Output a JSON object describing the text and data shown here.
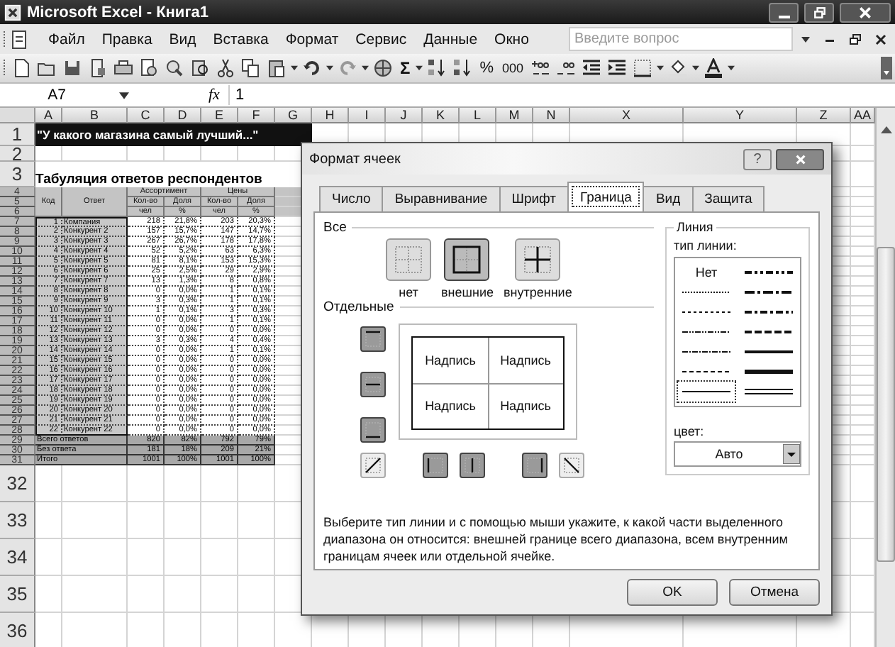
{
  "window": {
    "title": "Microsoft Excel - Книга1"
  },
  "menu": [
    "Файл",
    "Правка",
    "Вид",
    "Вставка",
    "Формат",
    "Сервис",
    "Данные",
    "Окно"
  ],
  "help_search": {
    "placeholder": "Введите вопрос"
  },
  "toolbar": {
    "sum": "Σ",
    "percent": "%",
    "thousands": "000"
  },
  "formula_bar": {
    "name_box": "A7",
    "fx": "fx",
    "value": "1"
  },
  "sheet": {
    "columns": [
      "A",
      "B",
      "C",
      "D",
      "E",
      "F",
      "G",
      "H",
      "I",
      "J",
      "K",
      "L",
      "M",
      "N",
      "X",
      "Y",
      "Z",
      "AA"
    ],
    "row_numbers": [
      "1",
      "2",
      "3",
      "4",
      "5",
      "6",
      "7",
      "8",
      "9",
      "10",
      "11",
      "12",
      "13",
      "14",
      "15",
      "16",
      "17",
      "18",
      "19",
      "20",
      "21",
      "22",
      "23",
      "24",
      "25",
      "26",
      "27",
      "28",
      "29",
      "30",
      "31",
      "32",
      "33",
      "34",
      "35",
      "36"
    ],
    "title": "\"У какого магазина самый лучший...\"",
    "subtitle": "Табуляция ответов респондентов",
    "head": {
      "code": "Код",
      "answer": "Ответ",
      "groups": [
        "Ассортимент",
        "Цены"
      ],
      "measures": [
        "Кол-во",
        "Доля",
        "Кол-во",
        "Доля"
      ],
      "units": [
        "чел",
        "%",
        "чел",
        "%"
      ]
    },
    "rows": [
      {
        "code": "1",
        "answer": "Компания",
        "values": [
          "218",
          "21,8%",
          "203",
          "20,3%"
        ],
        "selected": true
      },
      {
        "code": "2",
        "answer": "Конкурент 2",
        "values": [
          "157",
          "15,7%",
          "147",
          "14,7%"
        ],
        "selected": true
      },
      {
        "code": "3",
        "answer": "Конкурент 3",
        "values": [
          "267",
          "26,7%",
          "178",
          "17,8%"
        ],
        "selected": true
      },
      {
        "code": "4",
        "answer": "Конкурент 4",
        "values": [
          "52",
          "5,2%",
          "63",
          "6,3%"
        ],
        "selected": true
      },
      {
        "code": "5",
        "answer": "Конкурент 5",
        "values": [
          "81",
          "8,1%",
          "153",
          "15,3%"
        ],
        "selected": true
      },
      {
        "code": "6",
        "answer": "Конкурент 6",
        "values": [
          "25",
          "2,5%",
          "29",
          "2,9%"
        ],
        "selected": true
      },
      {
        "code": "7",
        "answer": "Конкурент 7",
        "values": [
          "13",
          "1,3%",
          "8",
          "0,8%"
        ],
        "selected": true
      },
      {
        "code": "8",
        "answer": "Конкурент 8",
        "values": [
          "0",
          "0,0%",
          "1",
          "0,1%"
        ],
        "selected": true
      },
      {
        "code": "9",
        "answer": "Конкурент 9",
        "values": [
          "3",
          "0,3%",
          "1",
          "0,1%"
        ],
        "selected": true
      },
      {
        "code": "10",
        "answer": "Конкурент 10",
        "values": [
          "1",
          "0,1%",
          "3",
          "0,3%"
        ],
        "selected": true
      },
      {
        "code": "11",
        "answer": "Конкурент 11",
        "values": [
          "0",
          "0,0%",
          "1",
          "0,1%"
        ],
        "selected": true
      },
      {
        "code": "12",
        "answer": "Конкурент 12",
        "values": [
          "0",
          "0,0%",
          "0",
          "0,0%"
        ],
        "selected": true
      },
      {
        "code": "13",
        "answer": "Конкурент 13",
        "values": [
          "3",
          "0,3%",
          "4",
          "0,4%"
        ],
        "selected": true
      },
      {
        "code": "14",
        "answer": "Конкурент 14",
        "values": [
          "0",
          "0,0%",
          "1",
          "0,1%"
        ],
        "selected": true
      },
      {
        "code": "15",
        "answer": "Конкурент 15",
        "values": [
          "0",
          "0,0%",
          "0",
          "0,0%"
        ],
        "selected": true
      },
      {
        "code": "16",
        "answer": "Конкурент 16",
        "values": [
          "0",
          "0,0%",
          "0",
          "0,0%"
        ],
        "selected": true
      },
      {
        "code": "17",
        "answer": "Конкурент 17",
        "values": [
          "0",
          "0,0%",
          "0",
          "0,0%"
        ],
        "selected": true
      },
      {
        "code": "18",
        "answer": "Конкурент 18",
        "values": [
          "0",
          "0,0%",
          "0",
          "0,0%"
        ],
        "selected": true
      },
      {
        "code": "19",
        "answer": "Конкурент 19",
        "values": [
          "0",
          "0,0%",
          "0",
          "0,0%"
        ],
        "selected": true
      },
      {
        "code": "20",
        "answer": "Конкурент 20",
        "values": [
          "0",
          "0,0%",
          "0",
          "0,0%"
        ],
        "selected": true
      },
      {
        "code": "21",
        "answer": "Конкурент 21",
        "values": [
          "0",
          "0,0%",
          "0",
          "0,0%"
        ],
        "selected": true
      },
      {
        "code": "22",
        "answer": "Конкурент 22",
        "values": [
          "0",
          "0,0%",
          "0",
          "0,0%"
        ],
        "selected": true
      }
    ],
    "totals": [
      {
        "label": "Всего ответов",
        "values": [
          "820",
          "82%",
          "792",
          "79%"
        ]
      },
      {
        "label": "Без ответа",
        "values": [
          "181",
          "18%",
          "209",
          "21%"
        ]
      },
      {
        "label": "Итого",
        "values": [
          "1001",
          "100%",
          "1001",
          "100%"
        ]
      }
    ]
  },
  "dialog": {
    "title": "Формат ячеек",
    "help": "?",
    "tabs": [
      {
        "label": "Число",
        "selected": false
      },
      {
        "label": "Выравнивание",
        "selected": false
      },
      {
        "label": "Шрифт",
        "selected": false
      },
      {
        "label": "Граница",
        "selected": true
      },
      {
        "label": "Вид",
        "selected": false
      },
      {
        "label": "Защита",
        "selected": false
      }
    ],
    "all_label": "Все",
    "presets": [
      {
        "label": "нет",
        "kind": "none",
        "selected": false
      },
      {
        "label": "внешние",
        "kind": "outline",
        "selected": true
      },
      {
        "label": "внутренние",
        "kind": "inside",
        "selected": false
      }
    ],
    "individual_label": "Отдельные",
    "preview_labels": [
      "Надпись",
      "Надпись",
      "Надпись",
      "Надпись"
    ],
    "side_buttons": [
      {
        "kind": "top",
        "on": true
      },
      {
        "kind": "middle",
        "on": true
      },
      {
        "kind": "bottom",
        "on": true
      }
    ],
    "bottom_buttons": [
      {
        "kind": "diag_up",
        "on": false
      },
      {
        "kind": "left",
        "on": true
      },
      {
        "kind": "center",
        "on": true
      },
      {
        "kind": "right",
        "on": true
      },
      {
        "kind": "diag_down",
        "on": false
      }
    ],
    "line_group": "Линия",
    "line_type_label": "тип линии:",
    "line_styles": [
      {
        "kind": "none",
        "label": "Нет",
        "selected": false
      },
      {
        "kind": "hair",
        "selected": false
      },
      {
        "kind": "dotted",
        "selected": false
      },
      {
        "kind": "dashdotdot",
        "selected": false
      },
      {
        "kind": "dashdot",
        "selected": false
      },
      {
        "kind": "dashed",
        "selected": false
      },
      {
        "kind": "thin",
        "selected": true
      },
      {
        "kind": "mediumdashdotdot",
        "selected": false
      },
      {
        "kind": "slantdashdot",
        "selected": false
      },
      {
        "kind": "mediumdashdot",
        "selected": false
      },
      {
        "kind": "mediumdashed",
        "selected": false
      },
      {
        "kind": "medium",
        "selected": false
      },
      {
        "kind": "thick",
        "selected": false
      },
      {
        "kind": "double",
        "selected": false
      }
    ],
    "color_label": "цвет:",
    "color_value": "Авто",
    "description": "Выберите тип линии и с помощью мыши укажите, к какой части выделенного диапазона он относится: внешней границе всего диапазона, всем внутренним границам ячеек или отдельной ячейке.",
    "buttons": [
      "OK",
      "Отмена"
    ]
  }
}
